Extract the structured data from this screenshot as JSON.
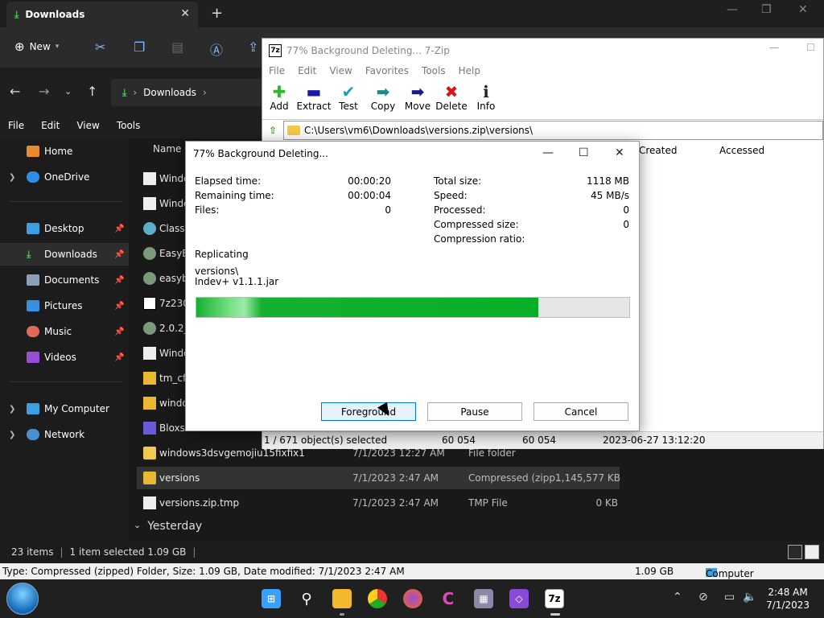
{
  "explorer": {
    "tab_title": "Downloads",
    "new_label": "New",
    "address": [
      "Downloads"
    ],
    "menu": [
      "File",
      "Edit",
      "View",
      "Tools"
    ],
    "sidebar": [
      {
        "label": "Home",
        "pin": false
      },
      {
        "label": "OneDrive",
        "pin": false
      },
      {
        "label": "Desktop",
        "pin": true
      },
      {
        "label": "Downloads",
        "pin": true
      },
      {
        "label": "Documents",
        "pin": true
      },
      {
        "label": "Pictures",
        "pin": true
      },
      {
        "label": "Music",
        "pin": true
      },
      {
        "label": "Videos",
        "pin": true
      },
      {
        "label": "My Computer",
        "pin": false
      },
      {
        "label": "Network",
        "pin": false
      }
    ],
    "column_name": "Name",
    "partial_rows": [
      "Windo",
      "Windo",
      "Classi",
      "EasyB",
      "easyb",
      "7z230",
      "2.0.2_",
      "Windo",
      "tm_cf",
      "windo",
      "Bloxst"
    ],
    "rows": [
      {
        "name": "windows3dsvgemojiu15fixfix1",
        "date": "7/1/2023 12:27 AM",
        "type": "File folder",
        "size": ""
      },
      {
        "name": "versions",
        "date": "7/1/2023 2:47 AM",
        "type": "Compressed (zipp...",
        "size": "1,145,577 KB"
      },
      {
        "name": "versions.zip.tmp",
        "date": "7/1/2023 2:47 AM",
        "type": "TMP File",
        "size": "0 KB"
      }
    ],
    "group_yesterday": "Yesterday",
    "status": {
      "count": "23 items",
      "selected": "1 item selected  1.09 GB"
    }
  },
  "zip": {
    "title": "77% Background Deleting... 7-Zip",
    "menu": [
      "File",
      "Edit",
      "View",
      "Favorites",
      "Tools",
      "Help"
    ],
    "toolbar": [
      "Add",
      "Extract",
      "Test",
      "Copy",
      "Move",
      "Delete",
      "Info"
    ],
    "path": "C:\\Users\\vm6\\Downloads\\versions.zip\\versions\\",
    "col_created": "Created",
    "col_accessed": "Accessed",
    "status": {
      "selected": "1 / 671 object(s) selected",
      "size": "60 054",
      "packed": "60 054",
      "date": "2023-06-27 13:12:20"
    }
  },
  "dialog": {
    "title": "77% Background Deleting...",
    "left": [
      {
        "label": "Elapsed time:",
        "value": "00:00:20"
      },
      {
        "label": "Remaining time:",
        "value": "00:00:04"
      },
      {
        "label": "Files:",
        "value": "0"
      }
    ],
    "right": [
      {
        "label": "Total size:",
        "value": "1118 MB"
      },
      {
        "label": "Speed:",
        "value": "45 MB/s"
      },
      {
        "label": "Processed:",
        "value": "0"
      },
      {
        "label": "Compressed size:",
        "value": "0"
      },
      {
        "label": "Compression ratio:",
        "value": ""
      }
    ],
    "operation": "Replicating",
    "path_line1": "versions\\",
    "path_line2": "Indev+ v1.1.1.jar",
    "progress": 0.79,
    "buttons": {
      "foreground": "Foreground",
      "pause": "Pause",
      "cancel": "Cancel"
    }
  },
  "infostrip": {
    "text": "Type: Compressed (zipped) Folder, Size: 1.09 GB, Date modified: 7/1/2023 2:47 AM",
    "size": "1.09 GB",
    "location": "Computer"
  },
  "clock": {
    "time": "2:48 AM",
    "date": "7/1/2023"
  }
}
